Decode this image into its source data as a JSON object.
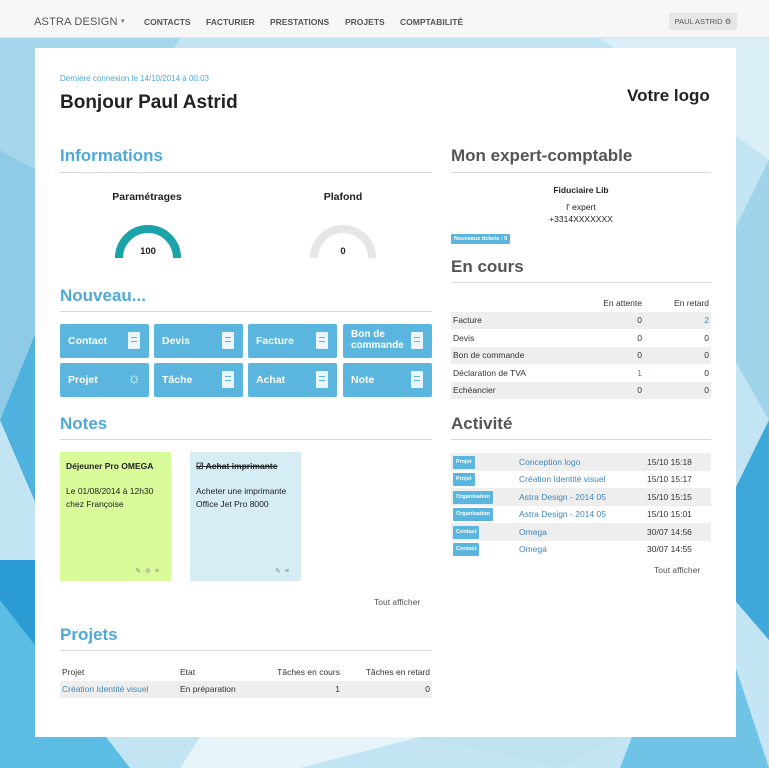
{
  "nav": {
    "brand": "ASTRA DESIGN",
    "links": [
      "CONTACTS",
      "FACTURIER",
      "PRESTATIONS",
      "PROJETS",
      "COMPTABILITÉ"
    ],
    "user": "PAUL ASTRID ⚙"
  },
  "header": {
    "last_login": "Dernière connexion le 14/10/2014 à 00:03",
    "greeting": "Bonjour Paul Astrid",
    "logo_text": "Votre logo"
  },
  "informations": {
    "title": "Informations",
    "gauges": [
      {
        "label": "Paramétrages",
        "value": 100,
        "display": "100"
      },
      {
        "label": "Plafond",
        "value": 0,
        "display": "0"
      }
    ]
  },
  "nouveau": {
    "title": "Nouveau...",
    "tiles": [
      "Contact",
      "Devis",
      "Facture",
      "Bon de commande",
      "Projet",
      "Tâche",
      "Achat",
      "Note"
    ]
  },
  "notes": {
    "title": "Notes",
    "items": [
      {
        "title": "Déjeuner Pro OMEGA",
        "body": "Le 01/08/2014 à 12h30 chez Françoise",
        "color": "#d9fb9a"
      },
      {
        "title": "Achat imprimante",
        "body": "Acheter une imprimante Office Jet Pro 8000",
        "color": "#d6edf6"
      }
    ],
    "show_all": "Tout afficher"
  },
  "projets": {
    "title": "Projets",
    "headers": [
      "Projet",
      "Etat",
      "Tâches en cours",
      "Tâches en retard"
    ],
    "rows": [
      [
        "Création Identité visuel",
        "En préparation",
        "1",
        "0"
      ]
    ]
  },
  "expert": {
    "title": "Mon expert-comptable",
    "name": "Fiduciaire Lib",
    "contact": "l' expert",
    "phone": "+3314XXXXXXX",
    "tickets": "Nouveaux tickets : 0"
  },
  "en_cours": {
    "title": "En cours",
    "headers": [
      "",
      "En attente",
      "En retard"
    ],
    "rows": [
      [
        "Facture",
        "0",
        "2"
      ],
      [
        "Devis",
        "0",
        "0"
      ],
      [
        "Bon de commande",
        "0",
        "0"
      ],
      [
        "Déclaration de TVA",
        "1",
        "0"
      ],
      [
        "Echéancier",
        "0",
        "0"
      ]
    ]
  },
  "activite": {
    "title": "Activité",
    "rows": [
      [
        "Projet",
        "Conception logo",
        "15/10 15:18"
      ],
      [
        "Projet",
        "Création Identité visuel",
        "15/10 15:17"
      ],
      [
        "Organisation",
        "Astra Design - 2014 05",
        "15/10 15:15"
      ],
      [
        "Organisation",
        "Astra Design - 2014 05",
        "15/10 15:01"
      ],
      [
        "Contact",
        "Omega",
        "30/07 14:56"
      ],
      [
        "Contact",
        "Omega",
        "30/07 14:55"
      ]
    ],
    "show_all": "Tout afficher"
  },
  "colors": {
    "accent": "#4ea9d8",
    "tile": "#5ab6de",
    "gauge": "#1aa3a8"
  }
}
